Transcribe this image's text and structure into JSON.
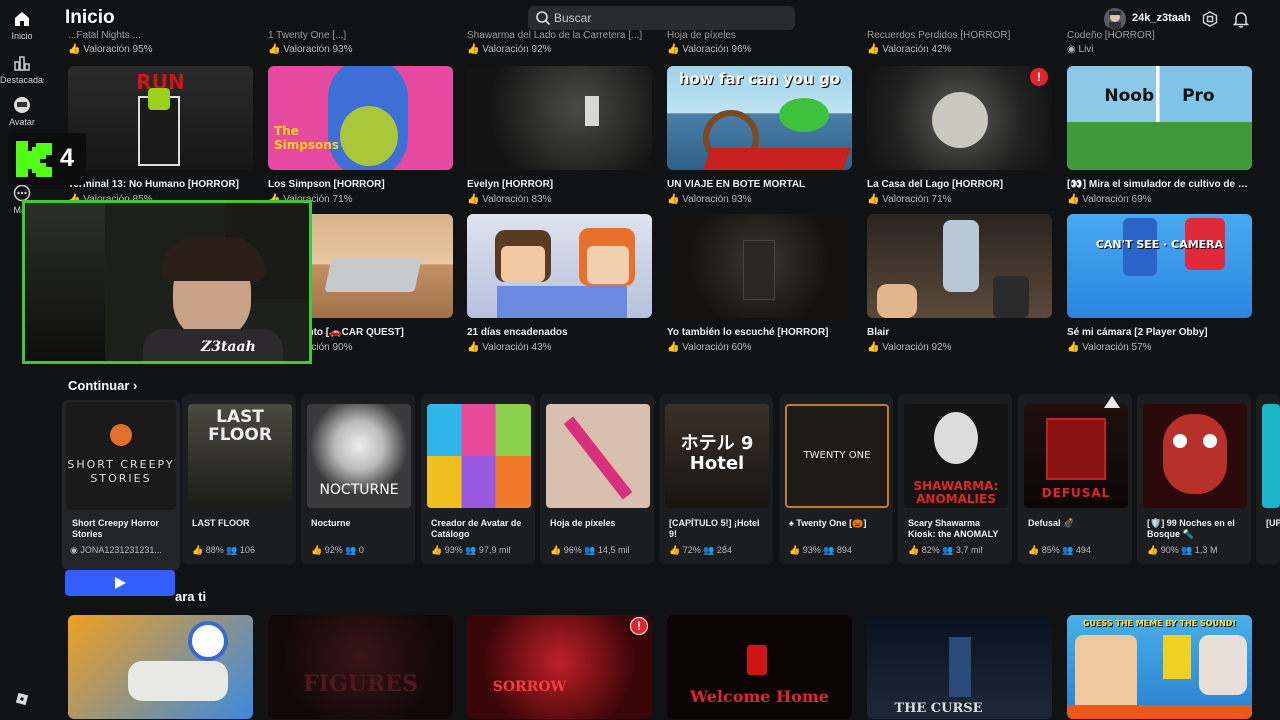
{
  "colors": {
    "bg": "#111214",
    "card": "#1c1d20",
    "accent": "#335fff",
    "kick": "#53fc18"
  },
  "sidebar": {
    "items": [
      {
        "label": "Inicio",
        "icon": "home-icon"
      },
      {
        "label": "Destacadas",
        "icon": "chart-icon"
      },
      {
        "label": "Avatar",
        "icon": "avatar-icon"
      },
      {
        "label": "Más",
        "icon": "more-icon"
      }
    ]
  },
  "header": {
    "title": "Inicio",
    "search_placeholder": "Buscar",
    "username": "24k_z3taah"
  },
  "top_partial": [
    {
      "title": "...Fatal Nights ...",
      "rating": "Valoración 95%"
    },
    {
      "title": "1 Twenty One [...]",
      "rating": "Valoración 93%"
    },
    {
      "title": "Shawarma del Lado de la Carretera [...]",
      "rating": "Valoración 92%"
    },
    {
      "title": "Hoja de píxeles",
      "rating": "Valoración 96%"
    },
    {
      "title": "Recuerdos Perdidos [HORROR]",
      "rating": "Valoración 42%"
    },
    {
      "title": "Codeño [HORROR]",
      "rating": "Livi"
    }
  ],
  "grid_row1": [
    {
      "title": "Terminal 13: No Humano [HORROR]",
      "rating": "Valoración 85%",
      "thumb_text": "RUN"
    },
    {
      "title": "Los Simpson [HORROR]",
      "rating": "Valoración 71%",
      "thumb_text": "The Simpsons"
    },
    {
      "title": "Evelyn [HORROR]",
      "rating": "Valoración 83%",
      "thumb_text": ""
    },
    {
      "title": "UN VIAJE EN BOTE MORTAL",
      "rating": "Valoración 93%",
      "thumb_text": "how far can you go"
    },
    {
      "title": "La Casa del Lago [HORROR]",
      "rating": "Valoración 71%",
      "thumb_text": ""
    },
    {
      "title": "[👀] Mira el simulador de cultivo de cés...",
      "rating": "Valoración 69%",
      "thumb_text": "Noob   Pro"
    }
  ],
  "grid_row2": [
    {
      "title": "Polvoriento [🚗CAR QUEST]",
      "rating": "Valoración 90%",
      "thumb_text": ""
    },
    {
      "title": "21 días encadenados",
      "rating": "Valoración 43%",
      "thumb_text": ""
    },
    {
      "title": "Yo también lo escuché [HORROR]",
      "rating": "Valoración 60%",
      "thumb_text": ""
    },
    {
      "title": "Blair",
      "rating": "Valoración 92%",
      "thumb_text": ""
    },
    {
      "title": "Sé mi cámara [2 Player Obby]",
      "rating": "Valoración 57%",
      "thumb_text": "CAN'T SEE · CAMERA"
    }
  ],
  "continue": {
    "title": "Continuar",
    "items": [
      {
        "name": "Short Creepy Horror Stories",
        "stats": "JONA1231231231...",
        "thumb_text": "SHORT CREEPY STORIES"
      },
      {
        "name": "LAST FLOOR",
        "stats": "👍 88%   👥 106",
        "thumb_text": "LAST FLOOR"
      },
      {
        "name": "Nocturne",
        "stats": "👍 92%   👥 0",
        "thumb_text": "NOCTURNE"
      },
      {
        "name": "Creador de Avatar de Catálogo",
        "stats": "👍 93%   👥 97,9 mil",
        "thumb_text": ""
      },
      {
        "name": "Hoja de píxeles",
        "stats": "👍 96%   👥 14,5 mil",
        "thumb_text": ""
      },
      {
        "name": "[CAPÍTULO 5!] ¡Hotel 9!",
        "stats": "👍 72%   👥 284",
        "thumb_text": "ホテル 9 Hotel"
      },
      {
        "name": "♠ Twenty One [🎃]",
        "stats": "👍 93%   👥 894",
        "thumb_text": "TWENTY ONE"
      },
      {
        "name": "Scary Shawarma Kiosk: the ANOMALY",
        "stats": "👍 82%   👥 3,7 mil",
        "thumb_text": "SHAWARMA: ANOMALIES"
      },
      {
        "name": "Defusal 💣",
        "stats": "👍 85%   👥 494",
        "thumb_text": "DEFUSAL"
      },
      {
        "name": "[🛡️] 99 Noches en el Bosque 🔦",
        "stats": "👍 90%   👥 1,3 M",
        "thumb_text": ""
      },
      {
        "name": "[UP",
        "stats": "",
        "thumb_text": ""
      }
    ]
  },
  "recommended": {
    "title": "ara ti",
    "items": [
      {
        "thumb_text": ""
      },
      {
        "thumb_text": "FIGURES"
      },
      {
        "thumb_text": "SORROW"
      },
      {
        "thumb_text": "Welcome Home"
      },
      {
        "thumb_text": "THE CURSE"
      },
      {
        "thumb_text": "GUESS THE MEME BY THE SOUND!"
      }
    ]
  },
  "overlay": {
    "kick_number": "4",
    "streamer_name": "Z3taah"
  }
}
